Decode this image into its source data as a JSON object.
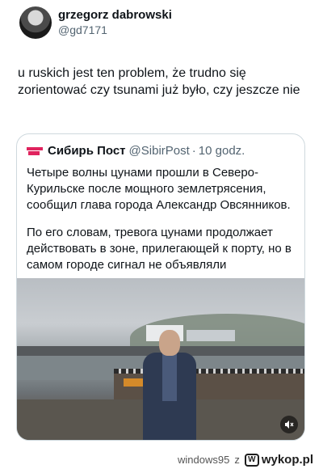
{
  "author": {
    "display_name": "grzegorz dabrowski",
    "handle": "@gd7171"
  },
  "tweet": {
    "text": "u ruskich jest ten problem, że trudno się zorientować czy tsunami już było, czy jeszcze nie"
  },
  "quote": {
    "source_name": "Сибирь Пост",
    "source_handle": "@SibirPost",
    "separator": "·",
    "time_ago": "10 godz.",
    "paragraph_1": "Четыре волны цунами прошли в Северо-Курильске  после мощного землетрясения, сообщил глава города Александр Овсянников.",
    "paragraph_2": "По его словам, тревога цунами продолжает действовать в зоне, прилегающей к порту, но в самом городе сигнал не объявляли",
    "media_control_icon": "speaker-muted-icon"
  },
  "footer": {
    "username": "windows95",
    "separator": "z",
    "site": "wykop.pl"
  },
  "colors": {
    "text": "#0f1419",
    "secondary_text": "#536471",
    "border": "#cfd9de",
    "brand_logo": "#e0245e"
  }
}
